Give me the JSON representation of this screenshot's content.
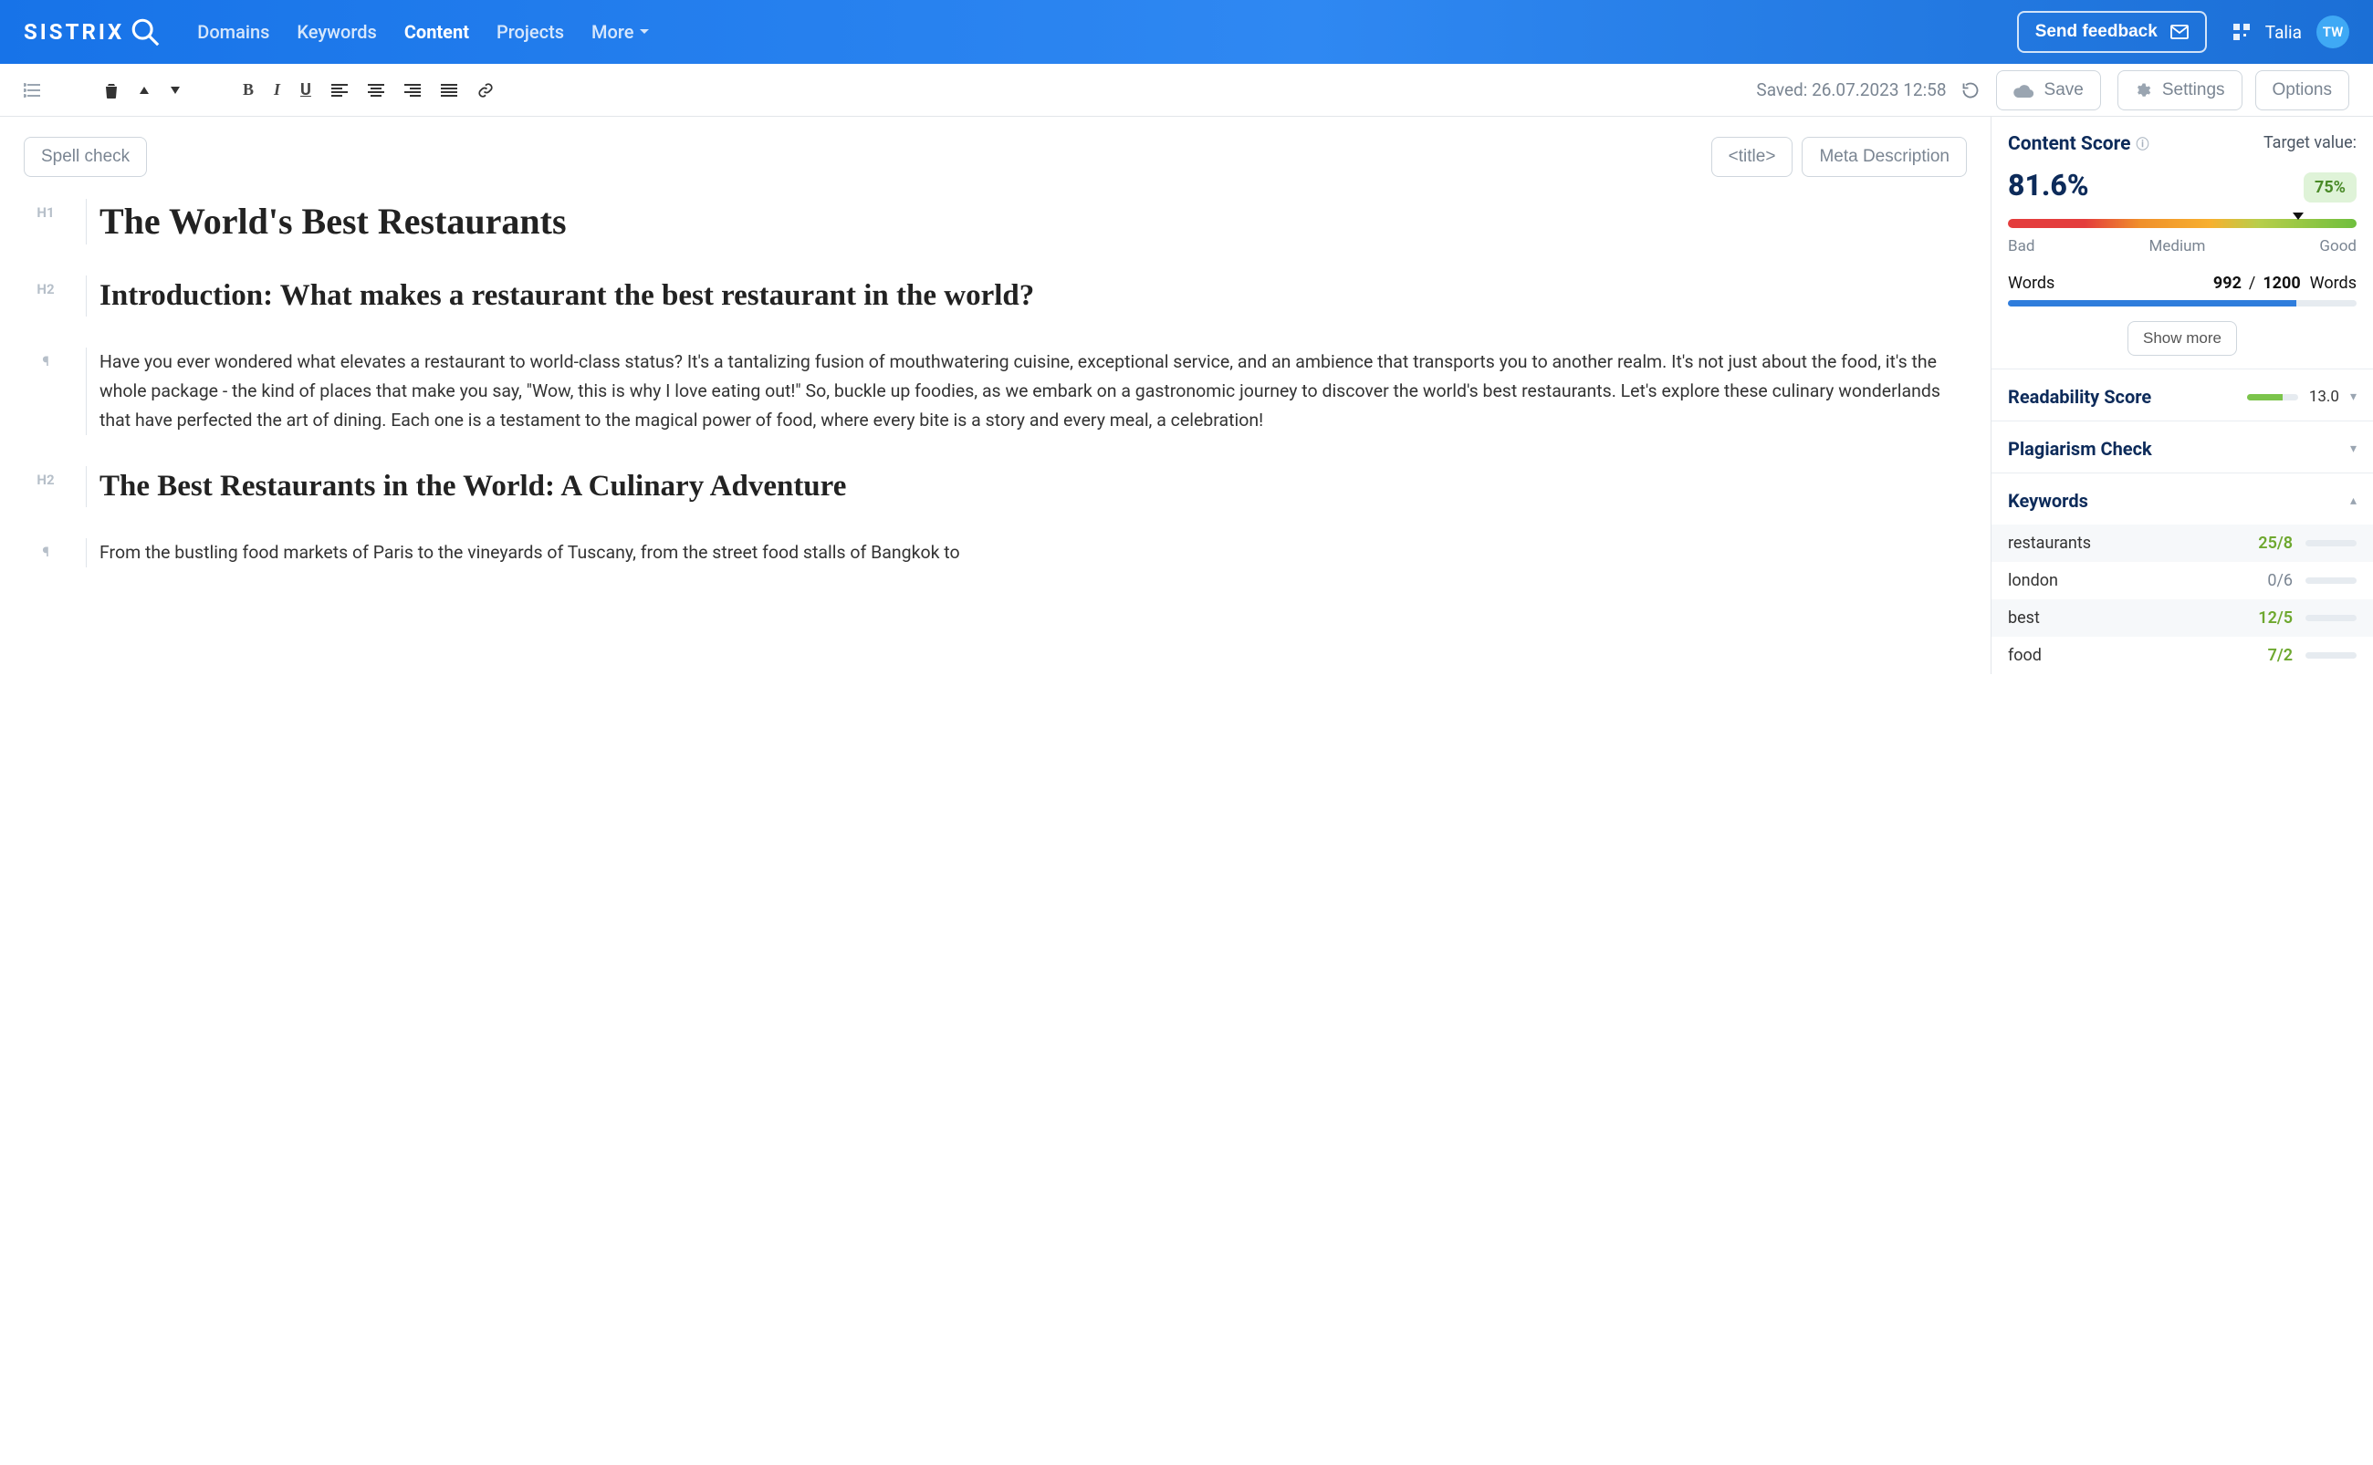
{
  "brand": "SISTRIX",
  "nav": {
    "domains": "Domains",
    "keywords": "Keywords",
    "content": "Content",
    "projects": "Projects",
    "more": "More"
  },
  "feedback_label": "Send feedback",
  "user": {
    "name": "Talia",
    "initials": "TW"
  },
  "toolbar": {
    "saved_text": "Saved: 26.07.2023 12:58",
    "save_label": "Save",
    "settings_label": "Settings",
    "options_label": "Options"
  },
  "quick": {
    "spellcheck": "Spell check",
    "title_tag": "<title>",
    "meta": "Meta Description"
  },
  "doc": {
    "h1": "The World's Best Restaurants",
    "h2a": "Introduction: What makes a restaurant the best restaurant in the world?",
    "p1": "Have you ever wondered what elevates a restaurant to world-class status? It's a tantalizing fusion of mouthwatering cuisine, exceptional service, and an ambience that transports you to another realm. It's not just about the food, it's the whole package - the kind of places that make you say, \"Wow, this is why I love eating out!\" So, buckle up foodies, as we embark on a gastronomic journey to discover the world's best restaurants. Let's explore these culinary wonderlands that have perfected the art of dining. Each one is a testament to the magical power of food, where every bite is a story and every meal, a celebration!",
    "h2b": "The Best Restaurants in the World: A Culinary Adventure",
    "p2": "From the bustling food markets of Paris to the vineyards of Tuscany, from the street food stalls of Bangkok to"
  },
  "side": {
    "content_score_label": "Content Score",
    "target_label": "Target value:",
    "score_pct": "81.6%",
    "target_pct": "75%",
    "bar_labels": {
      "bad": "Bad",
      "medium": "Medium",
      "good": "Good"
    },
    "words_label": "Words",
    "words_current": "992",
    "words_sep": "/",
    "words_target": "1200",
    "words_unit": "Words",
    "show_more": "Show more",
    "readability_label": "Readability Score",
    "readability_value": "13.0",
    "plagiarism_label": "Plagiarism Check",
    "keywords_label": "Keywords",
    "kw": [
      {
        "name": "restaurants",
        "count": "25/8",
        "zero": false,
        "pct": 100
      },
      {
        "name": "london",
        "count": "0/6",
        "zero": true,
        "pct": 0
      },
      {
        "name": "best",
        "count": "12/5",
        "zero": false,
        "pct": 100
      },
      {
        "name": "food",
        "count": "7/2",
        "zero": false,
        "pct": 100
      }
    ]
  }
}
